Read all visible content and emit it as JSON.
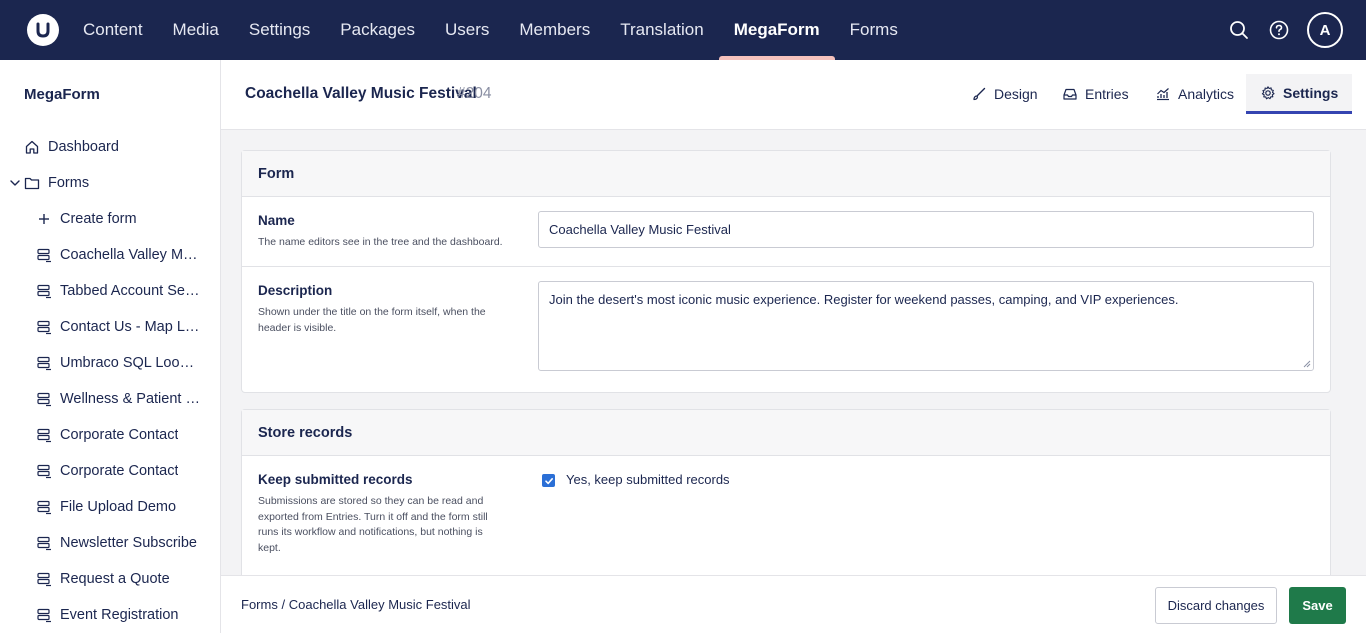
{
  "app": {
    "logo_icon": "umbraco-logo-icon",
    "nav": [
      {
        "label": "Content"
      },
      {
        "label": "Media"
      },
      {
        "label": "Settings"
      },
      {
        "label": "Packages"
      },
      {
        "label": "Users"
      },
      {
        "label": "Members"
      },
      {
        "label": "Translation"
      },
      {
        "label": "MegaForm",
        "active": true
      },
      {
        "label": "Forms"
      }
    ],
    "avatar_initial": "A",
    "accent_color": "#1b264f",
    "active_indicator_color": "#f5c1bc"
  },
  "sidebar": {
    "title": "MegaForm",
    "dashboard": "Dashboard",
    "forms_folder": "Forms",
    "create_form": "Create form",
    "forms": [
      "Coachella Valley Music Festival",
      "Tabbed Account Settings",
      "Contact Us - Map Layout",
      "Umbraco SQL Lookup",
      "Wellness & Patient Intake",
      "Corporate Contact",
      "Corporate Contact",
      "File Upload Demo",
      "Newsletter Subscribe",
      "Request a Quote",
      "Event Registration"
    ]
  },
  "workspace": {
    "title": "Coachella Valley Music Festival",
    "id": "#204",
    "tabs": {
      "design": "Design",
      "entries": "Entries",
      "analytics": "Analytics",
      "settings": "Settings"
    },
    "active_tab": "Settings"
  },
  "form_box": {
    "header": "Form",
    "name_label": "Name",
    "name_desc": "The name editors see in the tree and the dashboard.",
    "name_value": "Coachella Valley Music Festival",
    "description_label": "Description",
    "description_desc": "Shown under the title on the form itself, when the header is visible.",
    "description_value": "Join the desert's most iconic music experience. Register for weekend passes, camping, and VIP experiences."
  },
  "store_box": {
    "header": "Store records",
    "keep_label": "Keep submitted records",
    "keep_desc": "Submissions are stored so they can be read and exported from Entries. Turn it off and the form still runs its workflow and notifications, but nothing is kept.",
    "keep_checkbox_label": "Yes, keep submitted records",
    "keep_checked": true
  },
  "footer": {
    "breadcrumb_root": "Forms",
    "breadcrumb_sep": "/",
    "breadcrumb_current": "Coachella Valley Music Festival",
    "discard_label": "Discard changes",
    "save_label": "Save",
    "save_color": "#1f7a4a"
  }
}
